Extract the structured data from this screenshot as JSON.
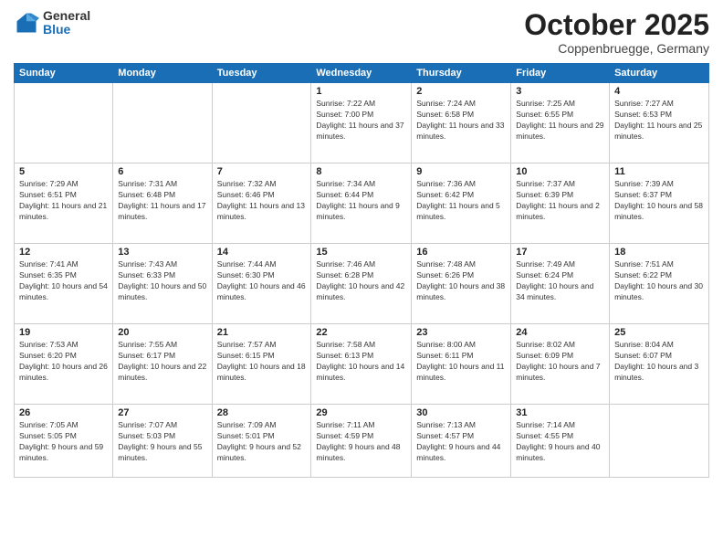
{
  "logo": {
    "general": "General",
    "blue": "Blue"
  },
  "title": "October 2025",
  "subtitle": "Coppenbruegge, Germany",
  "days": [
    "Sunday",
    "Monday",
    "Tuesday",
    "Wednesday",
    "Thursday",
    "Friday",
    "Saturday"
  ],
  "weeks": [
    [
      {
        "date": "",
        "info": ""
      },
      {
        "date": "",
        "info": ""
      },
      {
        "date": "",
        "info": ""
      },
      {
        "date": "1",
        "info": "Sunrise: 7:22 AM\nSunset: 7:00 PM\nDaylight: 11 hours and 37 minutes."
      },
      {
        "date": "2",
        "info": "Sunrise: 7:24 AM\nSunset: 6:58 PM\nDaylight: 11 hours and 33 minutes."
      },
      {
        "date": "3",
        "info": "Sunrise: 7:25 AM\nSunset: 6:55 PM\nDaylight: 11 hours and 29 minutes."
      },
      {
        "date": "4",
        "info": "Sunrise: 7:27 AM\nSunset: 6:53 PM\nDaylight: 11 hours and 25 minutes."
      }
    ],
    [
      {
        "date": "5",
        "info": "Sunrise: 7:29 AM\nSunset: 6:51 PM\nDaylight: 11 hours and 21 minutes."
      },
      {
        "date": "6",
        "info": "Sunrise: 7:31 AM\nSunset: 6:48 PM\nDaylight: 11 hours and 17 minutes."
      },
      {
        "date": "7",
        "info": "Sunrise: 7:32 AM\nSunset: 6:46 PM\nDaylight: 11 hours and 13 minutes."
      },
      {
        "date": "8",
        "info": "Sunrise: 7:34 AM\nSunset: 6:44 PM\nDaylight: 11 hours and 9 minutes."
      },
      {
        "date": "9",
        "info": "Sunrise: 7:36 AM\nSunset: 6:42 PM\nDaylight: 11 hours and 5 minutes."
      },
      {
        "date": "10",
        "info": "Sunrise: 7:37 AM\nSunset: 6:39 PM\nDaylight: 11 hours and 2 minutes."
      },
      {
        "date": "11",
        "info": "Sunrise: 7:39 AM\nSunset: 6:37 PM\nDaylight: 10 hours and 58 minutes."
      }
    ],
    [
      {
        "date": "12",
        "info": "Sunrise: 7:41 AM\nSunset: 6:35 PM\nDaylight: 10 hours and 54 minutes."
      },
      {
        "date": "13",
        "info": "Sunrise: 7:43 AM\nSunset: 6:33 PM\nDaylight: 10 hours and 50 minutes."
      },
      {
        "date": "14",
        "info": "Sunrise: 7:44 AM\nSunset: 6:30 PM\nDaylight: 10 hours and 46 minutes."
      },
      {
        "date": "15",
        "info": "Sunrise: 7:46 AM\nSunset: 6:28 PM\nDaylight: 10 hours and 42 minutes."
      },
      {
        "date": "16",
        "info": "Sunrise: 7:48 AM\nSunset: 6:26 PM\nDaylight: 10 hours and 38 minutes."
      },
      {
        "date": "17",
        "info": "Sunrise: 7:49 AM\nSunset: 6:24 PM\nDaylight: 10 hours and 34 minutes."
      },
      {
        "date": "18",
        "info": "Sunrise: 7:51 AM\nSunset: 6:22 PM\nDaylight: 10 hours and 30 minutes."
      }
    ],
    [
      {
        "date": "19",
        "info": "Sunrise: 7:53 AM\nSunset: 6:20 PM\nDaylight: 10 hours and 26 minutes."
      },
      {
        "date": "20",
        "info": "Sunrise: 7:55 AM\nSunset: 6:17 PM\nDaylight: 10 hours and 22 minutes."
      },
      {
        "date": "21",
        "info": "Sunrise: 7:57 AM\nSunset: 6:15 PM\nDaylight: 10 hours and 18 minutes."
      },
      {
        "date": "22",
        "info": "Sunrise: 7:58 AM\nSunset: 6:13 PM\nDaylight: 10 hours and 14 minutes."
      },
      {
        "date": "23",
        "info": "Sunrise: 8:00 AM\nSunset: 6:11 PM\nDaylight: 10 hours and 11 minutes."
      },
      {
        "date": "24",
        "info": "Sunrise: 8:02 AM\nSunset: 6:09 PM\nDaylight: 10 hours and 7 minutes."
      },
      {
        "date": "25",
        "info": "Sunrise: 8:04 AM\nSunset: 6:07 PM\nDaylight: 10 hours and 3 minutes."
      }
    ],
    [
      {
        "date": "26",
        "info": "Sunrise: 7:05 AM\nSunset: 5:05 PM\nDaylight: 9 hours and 59 minutes."
      },
      {
        "date": "27",
        "info": "Sunrise: 7:07 AM\nSunset: 5:03 PM\nDaylight: 9 hours and 55 minutes."
      },
      {
        "date": "28",
        "info": "Sunrise: 7:09 AM\nSunset: 5:01 PM\nDaylight: 9 hours and 52 minutes."
      },
      {
        "date": "29",
        "info": "Sunrise: 7:11 AM\nSunset: 4:59 PM\nDaylight: 9 hours and 48 minutes."
      },
      {
        "date": "30",
        "info": "Sunrise: 7:13 AM\nSunset: 4:57 PM\nDaylight: 9 hours and 44 minutes."
      },
      {
        "date": "31",
        "info": "Sunrise: 7:14 AM\nSunset: 4:55 PM\nDaylight: 9 hours and 40 minutes."
      },
      {
        "date": "",
        "info": ""
      }
    ]
  ]
}
